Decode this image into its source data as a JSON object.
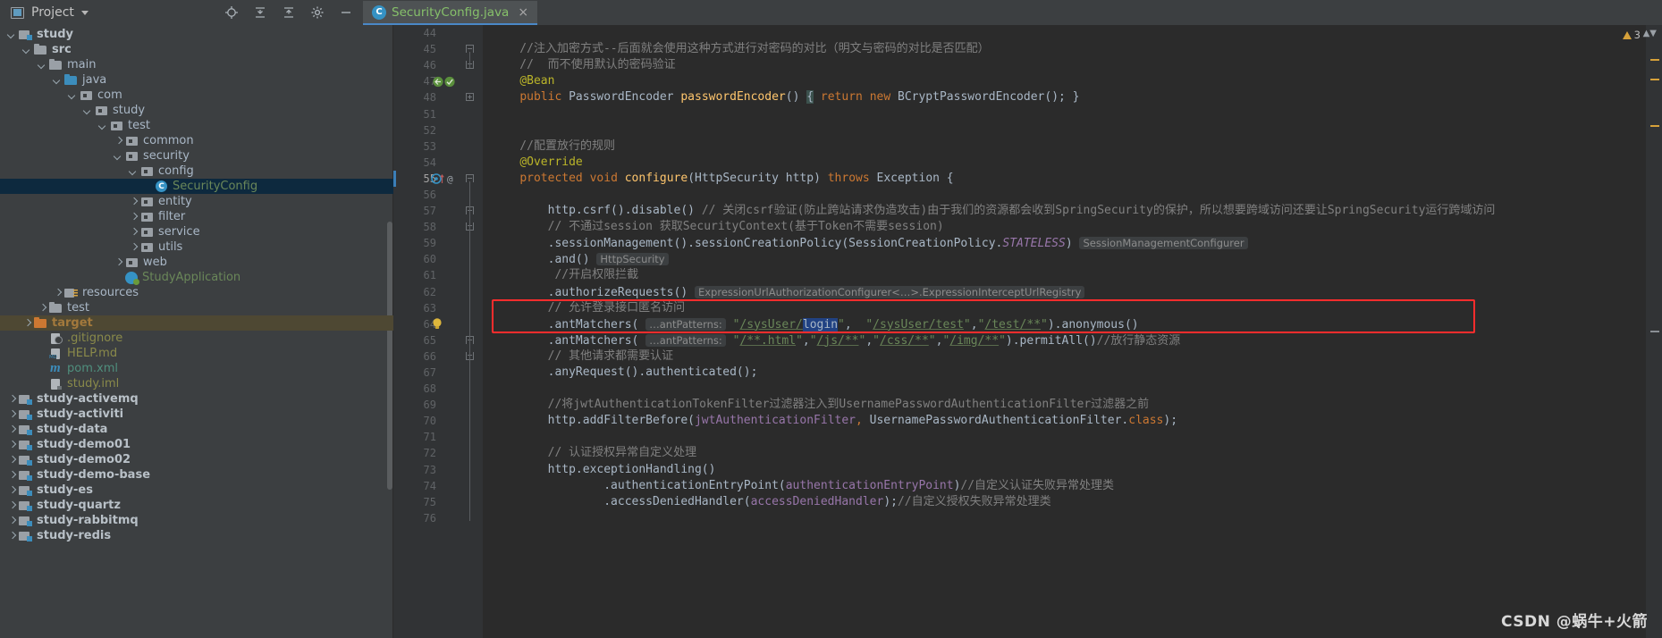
{
  "window": {
    "tool_panel_title": "Project",
    "toolbar_icons": [
      "locate-icon",
      "collapse-all-icon",
      "expand-icon",
      "settings-gear-icon",
      "minimize-icon"
    ]
  },
  "tabs": [
    {
      "label": "SecurityConfig.java",
      "class_badge": "C",
      "close_label": "×",
      "active": true
    }
  ],
  "tree": [
    {
      "label": "study",
      "depth": 1,
      "arrow": "open",
      "icon": "module-folder-icon",
      "style": "bold"
    },
    {
      "label": "src",
      "depth": 2,
      "arrow": "open",
      "icon": "folder-icon",
      "style": "bold"
    },
    {
      "label": "main",
      "depth": 3,
      "arrow": "open",
      "icon": "folder-icon",
      "style": "plain"
    },
    {
      "label": "java",
      "depth": 4,
      "arrow": "open",
      "icon": "source-folder-icon",
      "style": "plain"
    },
    {
      "label": "com",
      "depth": 5,
      "arrow": "open",
      "icon": "package-icon",
      "style": "plain"
    },
    {
      "label": "study",
      "depth": 6,
      "arrow": "open",
      "icon": "package-icon",
      "style": "plain"
    },
    {
      "label": "test",
      "depth": 7,
      "arrow": "open",
      "icon": "package-icon",
      "style": "plain"
    },
    {
      "label": "common",
      "depth": 8,
      "arrow": "closed",
      "icon": "package-icon",
      "style": "plain"
    },
    {
      "label": "security",
      "depth": 8,
      "arrow": "open",
      "icon": "package-icon",
      "style": "plain"
    },
    {
      "label": "config",
      "depth": 9,
      "arrow": "open",
      "icon": "package-icon",
      "style": "plain"
    },
    {
      "label": "SecurityConfig",
      "depth": 10,
      "arrow": "none",
      "icon": "java-class-icon",
      "style": "green",
      "selected": true
    },
    {
      "label": "entity",
      "depth": 9,
      "arrow": "closed",
      "icon": "package-icon",
      "style": "plain"
    },
    {
      "label": "filter",
      "depth": 9,
      "arrow": "closed",
      "icon": "package-icon",
      "style": "plain"
    },
    {
      "label": "service",
      "depth": 9,
      "arrow": "closed",
      "icon": "package-icon",
      "style": "plain"
    },
    {
      "label": "utils",
      "depth": 9,
      "arrow": "closed",
      "icon": "package-icon",
      "style": "plain"
    },
    {
      "label": "web",
      "depth": 8,
      "arrow": "closed",
      "icon": "package-icon",
      "style": "plain"
    },
    {
      "label": "StudyApplication",
      "depth": 8,
      "arrow": "none",
      "icon": "spring-boot-app-icon",
      "style": "green"
    },
    {
      "label": "resources",
      "depth": 4,
      "arrow": "closed",
      "icon": "resources-folder-icon",
      "style": "plain"
    },
    {
      "label": "test",
      "depth": 3,
      "arrow": "closed",
      "icon": "folder-icon",
      "style": "plain"
    },
    {
      "label": "target",
      "depth": 2,
      "arrow": "closed",
      "icon": "target-folder-icon",
      "style": "orange",
      "context": true
    },
    {
      "label": ".gitignore",
      "depth": 3,
      "arrow": "none",
      "icon": "gitignore-file-icon",
      "style": "olive"
    },
    {
      "label": "HELP.md",
      "depth": 3,
      "arrow": "none",
      "icon": "markdown-file-icon",
      "style": "olive"
    },
    {
      "label": "pom.xml",
      "depth": 3,
      "arrow": "none",
      "icon": "maven-file-icon",
      "style": "teal"
    },
    {
      "label": "study.iml",
      "depth": 3,
      "arrow": "none",
      "icon": "iml-file-icon",
      "style": "olive"
    },
    {
      "label": "study-activemq",
      "depth": 1,
      "arrow": "closed",
      "icon": "module-folder-icon",
      "style": "bold"
    },
    {
      "label": "study-activiti",
      "depth": 1,
      "arrow": "closed",
      "icon": "module-folder-icon",
      "style": "bold"
    },
    {
      "label": "study-data",
      "depth": 1,
      "arrow": "closed",
      "icon": "module-folder-icon",
      "style": "bold"
    },
    {
      "label": "study-demo01",
      "depth": 1,
      "arrow": "closed",
      "icon": "module-folder-icon",
      "style": "bold"
    },
    {
      "label": "study-demo02",
      "depth": 1,
      "arrow": "closed",
      "icon": "module-folder-icon",
      "style": "bold"
    },
    {
      "label": "study-demo-base",
      "depth": 1,
      "arrow": "closed",
      "icon": "module-folder-icon",
      "style": "bold"
    },
    {
      "label": "study-es",
      "depth": 1,
      "arrow": "closed",
      "icon": "module-folder-icon",
      "style": "bold"
    },
    {
      "label": "study-quartz",
      "depth": 1,
      "arrow": "closed",
      "icon": "module-folder-icon",
      "style": "bold"
    },
    {
      "label": "study-rabbitmq",
      "depth": 1,
      "arrow": "closed",
      "icon": "module-folder-icon",
      "style": "bold"
    },
    {
      "label": "study-redis",
      "depth": 1,
      "arrow": "closed",
      "icon": "module-folder-icon",
      "style": "bold"
    }
  ],
  "editor": {
    "current_line": 55,
    "line_numbers": [
      44,
      45,
      46,
      47,
      48,
      51,
      52,
      53,
      54,
      55,
      56,
      57,
      58,
      59,
      60,
      61,
      62,
      63,
      64,
      65,
      66,
      67,
      68,
      69,
      70,
      71,
      72,
      73,
      74,
      75,
      76
    ],
    "lines": {
      "44": "",
      "45": "    //注入加密方式--后面就会使用这种方式进行对密码的对比（明文与密码的对比是否匹配）",
      "46": "    //  而不使用默认的密码验证",
      "47": "    @Bean",
      "48": "    public PasswordEncoder passwordEncoder() { return new BCryptPasswordEncoder(); }",
      "51": "",
      "52": "",
      "53": "    //配置放行的规则",
      "54": "    @Override",
      "55": "    protected void configure(HttpSecurity http) throws Exception {",
      "56": "",
      "57": "        http.csrf().disable() // 关闭csrf验证(防止跨站请求伪造攻击)由于我们的资源都会收到SpringSecurity的保护，所以想要跨域访问还要让SpringSecurity运行跨域访问",
      "58": "        // 不通过session 获取SecurityContext(基于Token不需要session)",
      "59": "        .sessionManagement().sessionCreationPolicy(SessionCreationPolicy.STATELESS)",
      "60": "        .and()",
      "61": "         //开启权限拦截",
      "62": "        .authorizeRequests()",
      "63": "        // 允许登录接口匿名访问",
      "64": "        .antMatchers( \"/sysUser/login\",  \"/sysUser/test\",\"/test/**\").anonymous()",
      "65": "        .antMatchers( \"/**.html\",\"/js/**\",\"/css/**\",\"/img/**\").permitAll()//放行静态资源",
      "66": "        // 其他请求都需要认证",
      "67": "        .anyRequest().authenticated();",
      "68": "",
      "69": "        //将jwtAuthenticationTokenFilter过滤器注入到UsernamePasswordAuthenticationFilter过滤器之前",
      "70": "        http.addFilterBefore(jwtAuthenticationFilter, UsernamePasswordAuthenticationFilter.class);",
      "71": "",
      "72": "        // 认证授权异常自定义处理",
      "73": "        http.exceptionHandling()",
      "74": "                .authenticationEntryPoint(authenticationEntryPoint)//自定义认证失败异常处理类",
      "75": "                .accessDeniedHandler(accessDeniedHandler);//自定义授权失败异常处理类",
      "76": ""
    },
    "inlay_hints": {
      "line_59": "SessionManagementConfigurer<HttpSecurity>",
      "line_60": "HttpSecurity",
      "line_62": "ExpressionUrlAuthorizationConfigurer<…>.ExpressionInterceptUrlRegistry",
      "line_64": "…antPatterns:",
      "line_65": "…antPatterns:"
    },
    "selection": {
      "line": 64,
      "text": "login"
    },
    "annotation_box": {
      "lines": [
        63,
        64
      ],
      "color": "#ff2d2d"
    },
    "intention_bulb": {
      "line": 64,
      "icon": "lightbulb-icon"
    }
  },
  "status": {
    "warning_count": "3",
    "warning_icon": "warning-triangle-icon",
    "nav_up_icon": "chevron-up-icon",
    "nav_down_icon": "chevron-down-icon"
  },
  "watermark": "CSDN @蜗牛+火箭",
  "colors": {
    "accent": "#3592c4",
    "tab_underline": "#4a88c7",
    "selection": "#214283",
    "tree_selected": "#0d293e",
    "tree_context": "#4e4833",
    "annotation_red": "#ff2d2d",
    "editor_bg": "#2b2b2b",
    "panel_bg": "#3c3f41",
    "string_green": "#6a8759",
    "keyword_orange": "#cc7832",
    "annotation_yellow": "#bbb529",
    "comment_grey": "#808080",
    "method_yellow": "#ffc66d",
    "field_purple": "#9876aa"
  }
}
